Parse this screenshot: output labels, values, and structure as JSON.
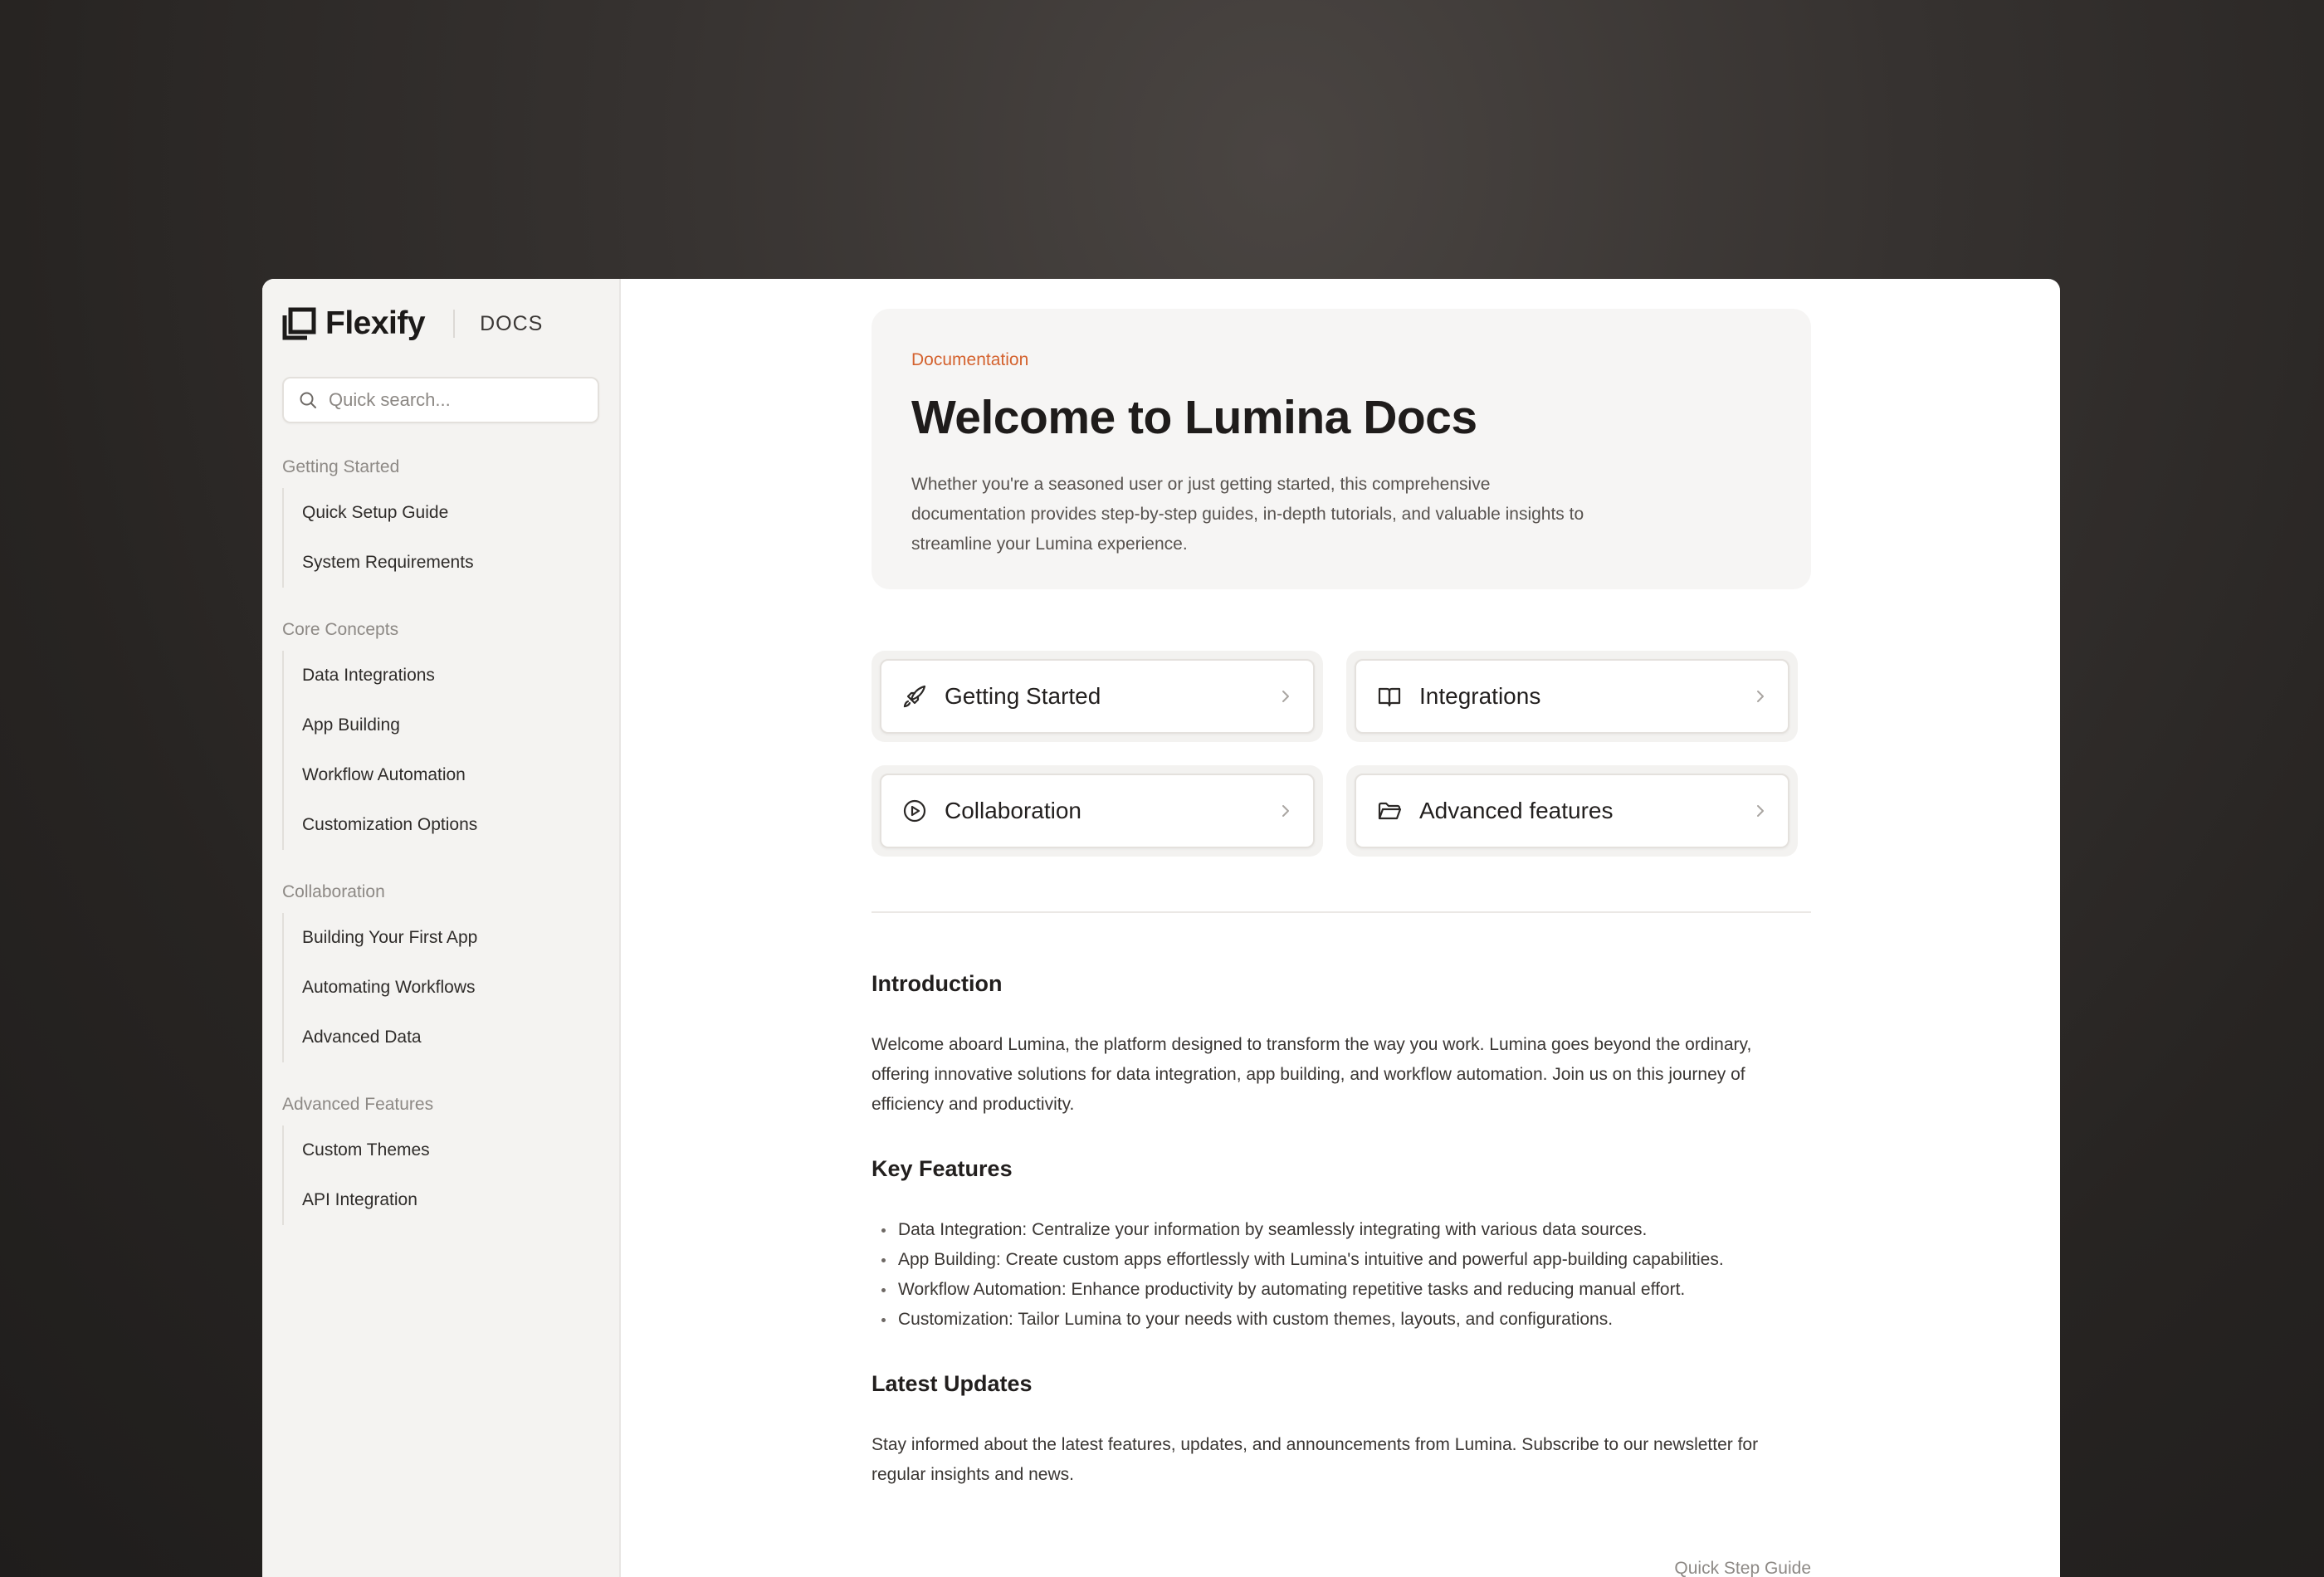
{
  "brand": {
    "name": "Flexify",
    "section": "DOCS"
  },
  "search": {
    "placeholder": "Quick search..."
  },
  "sidebar": {
    "groups": [
      {
        "heading": "Getting Started",
        "items": [
          "Quick Setup Guide",
          "System Requirements"
        ]
      },
      {
        "heading": "Core Concepts",
        "items": [
          "Data Integrations",
          "App Building",
          "Workflow Automation",
          "Customization Options"
        ]
      },
      {
        "heading": "Collaboration",
        "items": [
          "Building Your First App",
          "Automating Workflows",
          "Advanced Data"
        ]
      },
      {
        "heading": "Advanced Features",
        "items": [
          "Custom Themes",
          "API Integration"
        ]
      }
    ]
  },
  "hero": {
    "eyebrow": "Documentation",
    "title": "Welcome to Lumina Docs",
    "description": "Whether you're a seasoned user or just getting started, this comprehensive documentation provides step-by-step guides, in-depth tutorials, and valuable insights to streamline your Lumina experience."
  },
  "cards": [
    {
      "label": "Getting Started",
      "icon": "rocket-icon"
    },
    {
      "label": "Integrations",
      "icon": "book-open-icon"
    },
    {
      "label": "Collaboration",
      "icon": "play-circle-icon"
    },
    {
      "label": "Advanced features",
      "icon": "folder-icon"
    }
  ],
  "intro": {
    "title": "Introduction",
    "text": "Welcome aboard Lumina, the platform designed to transform the way you work. Lumina goes beyond the ordinary, offering innovative solutions for data integration, app building, and workflow automation. Join us on this journey of efficiency and productivity."
  },
  "key_features": {
    "title": "Key Features",
    "items": [
      "Data Integration: Centralize your information by seamlessly integrating with various data sources.",
      "App Building: Create custom apps effortlessly with Lumina's intuitive and powerful app-building capabilities.",
      "Workflow Automation: Enhance productivity by automating repetitive tasks and reducing manual effort.",
      "Customization: Tailor Lumina to your needs with custom themes, layouts, and configurations."
    ]
  },
  "updates": {
    "title": "Latest Updates",
    "text": "Stay informed about the latest features, updates, and announcements from Lumina. Subscribe to our newsletter for regular insights and news."
  },
  "footer": {
    "next_link": "Quick Step Guide"
  },
  "colors": {
    "accent": "#d4622e",
    "sidebar_bg": "#f4f3f1",
    "hero_bg": "#f6f5f4",
    "text": "#1f1c1b"
  }
}
